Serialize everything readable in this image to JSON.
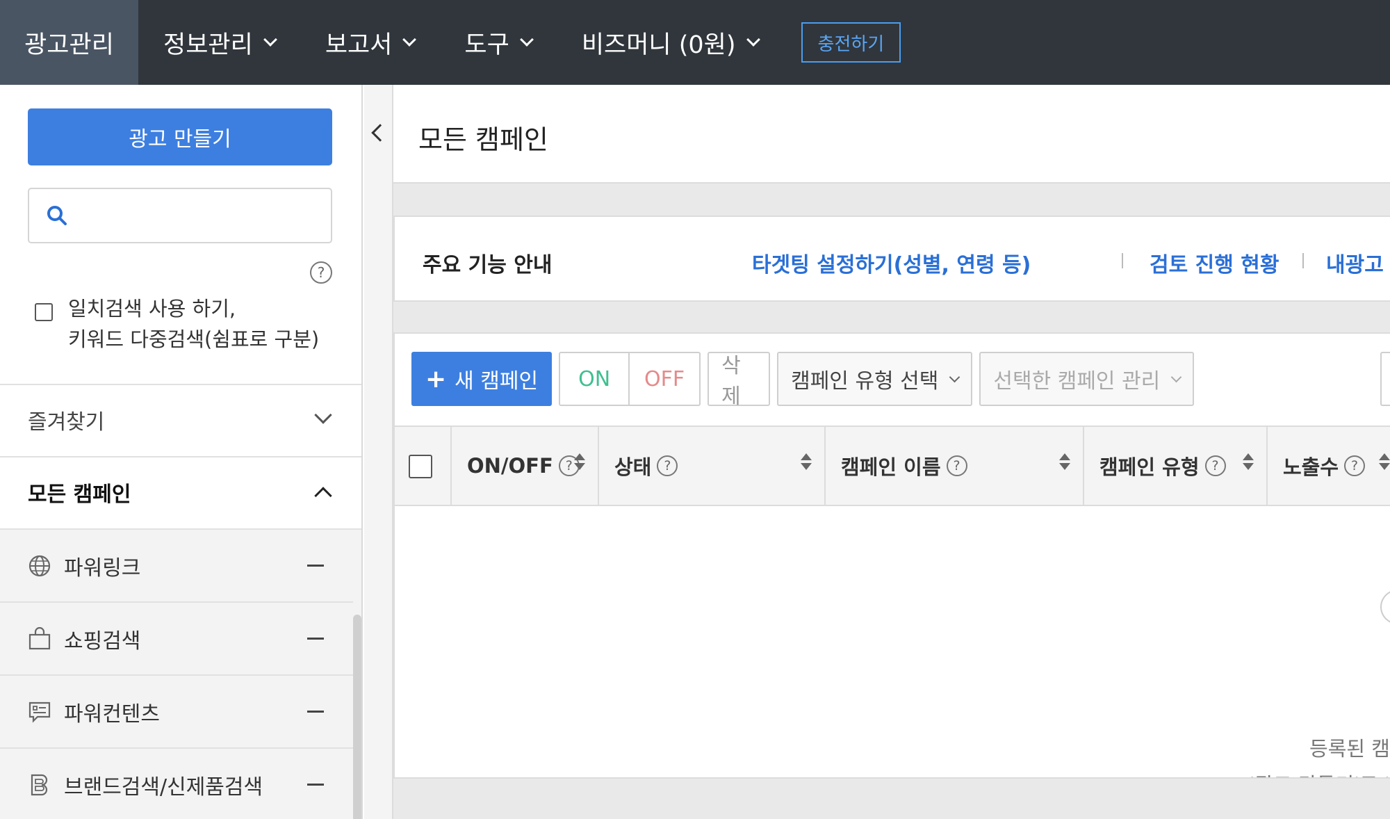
{
  "topnav": {
    "items": [
      {
        "label": "광고관리",
        "active": true,
        "dropdown": false
      },
      {
        "label": "정보관리",
        "dropdown": true
      },
      {
        "label": "보고서",
        "dropdown": true
      },
      {
        "label": "도구",
        "dropdown": true
      },
      {
        "label": "비즈머니 (0원)",
        "dropdown": true
      }
    ],
    "charge_label": "충전하기"
  },
  "sidebar": {
    "create_label": "광고 만들기",
    "search": {
      "value": "",
      "placeholder": ""
    },
    "help_icon": "?",
    "exact_search": {
      "line1": "일치검색 사용 하기,",
      "line2": "키워드 다중검색(쉼표로 구분)",
      "checked": false
    },
    "favorites_label": "즐겨찾기",
    "all_campaigns_label": "모든 캠페인",
    "campaign_types": [
      {
        "label": "파워링크",
        "icon": "globe-icon"
      },
      {
        "label": "쇼핑검색",
        "icon": "shopping-bag-icon"
      },
      {
        "label": "파워컨텐츠",
        "icon": "chat-card-icon"
      },
      {
        "label": "브랜드검색/신제품검색",
        "icon": "brand-b-icon"
      }
    ]
  },
  "main": {
    "page_title": "모든 캠페인",
    "features": {
      "title": "주요 기능 안내",
      "links": [
        "타겟팅 설정하기(성별, 연령 등)",
        "검토 진행 현황",
        "내광고 노출"
      ]
    },
    "toolbar": {
      "new_campaign": "새 캠페인",
      "on": "ON",
      "off": "OFF",
      "delete": "삭제",
      "type_select": "캠페인 유형 선택",
      "manage_select": "선택한 캠페인 관리"
    },
    "table": {
      "headers": [
        {
          "label": "ON/OFF",
          "help": true
        },
        {
          "label": "상태",
          "help": true
        },
        {
          "label": "캠페인 이름",
          "help": true
        },
        {
          "label": "캠페인 유형",
          "help": true
        },
        {
          "label": "노출수",
          "help": true
        }
      ],
      "empty_line1": "등록된 캠",
      "empty_line2": "'광고 만들기'로 '"
    }
  },
  "colors": {
    "nav_bg": "#30363c",
    "accent": "#3d7fe0",
    "link": "#2a6fd6",
    "on": "#3fbf8f",
    "off": "#e58a8a"
  }
}
